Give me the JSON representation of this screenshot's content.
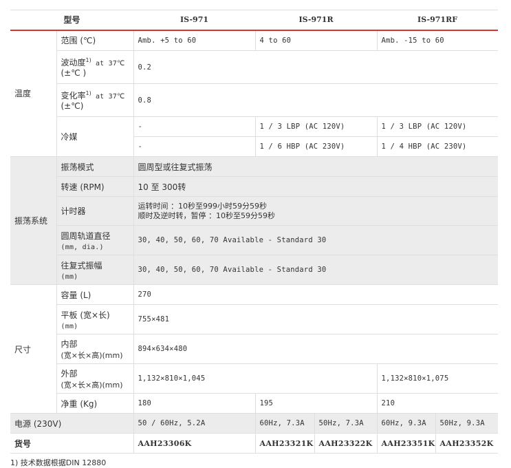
{
  "header": {
    "model": "型号",
    "c1": "IS-971",
    "c2": "IS-971R",
    "c3": "IS-971RF"
  },
  "temperature": {
    "group": "温度",
    "range_label": "范围 (℃)",
    "range": [
      "Amb. +5 to 60",
      "4 to 60",
      "Amb. -15 to 60"
    ],
    "fluct_label": "波动度",
    "fluct_sup": "1)",
    "fluct_at": " at 37℃",
    "fluct_unit": "(±℃ )",
    "fluct_value": "0.2",
    "var_label": "变化率",
    "var_sup": "1)",
    "var_at": " at 37℃",
    "var_unit": "(±℃)",
    "var_value": "0.8",
    "refrig_label": "冷媒",
    "refrig_r1": [
      "-",
      "1 / 3 LBP (AC 120V)",
      "1 / 3 LBP (AC 120V)"
    ],
    "refrig_r2": [
      "-",
      "1 / 6 HBP (AC 230V)",
      "1 / 4 HBP (AC 230V)"
    ]
  },
  "shaking": {
    "group": "振荡系统",
    "mode_label": "振荡模式",
    "mode_value": "圆周型或往复式振荡",
    "speed_label": "转速 (RPM)",
    "speed_value": "10 至 300转",
    "timer_label": "计时器",
    "timer_line1": "运转时间 ：10秒至999小时59分59秒",
    "timer_line2": "顺时及逆时转，暂停 ：10秒至59分59秒",
    "orbit_label": "圆周轨道直径",
    "orbit_unit": "(mm, dia.)",
    "orbit_value": "30, 40, 50, 60, 70 Available - Standard 30",
    "amp_label": "往复式振幅",
    "amp_unit": "(mm)",
    "amp_value": "30, 40, 50, 60, 70 Available - Standard 30"
  },
  "dimensions": {
    "group": "尺寸",
    "capacity_label": "容量 (L)",
    "capacity_value": "270",
    "plate_label": "平板 (宽×长)",
    "plate_unit": "(mm)",
    "plate_value": "755×481",
    "inner_label": "内部",
    "inner_unit": "(宽×长×高)(mm)",
    "inner_value": "894×634×480",
    "outer_label": "外部",
    "outer_unit": "(宽×长×高)(mm)",
    "outer_value_a": "1,132×810×1,045",
    "outer_value_b": "1,132×810×1,075",
    "weight_label": "净重 (Kg)",
    "weight": [
      "180",
      "195",
      "210"
    ]
  },
  "power": {
    "label": "电源 (230V)",
    "values": [
      "50 / 60Hz, 5.2A",
      "60Hz, 7.3A",
      "50Hz, 7.3A",
      "60Hz, 9.3A",
      "50Hz, 9.3A"
    ]
  },
  "catalog": {
    "label": "货号",
    "codes": [
      "AAH23306K",
      "AAH23321K",
      "AAH23322K",
      "AAH23351K",
      "AAH23352K"
    ]
  },
  "footnote": "1) 技术数据根据DIN 12880"
}
